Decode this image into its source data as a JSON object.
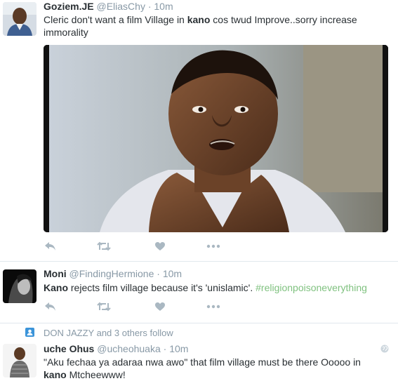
{
  "tweets": [
    {
      "name": "Goziem.JE",
      "handle": "@EliasChy",
      "separator": "·",
      "time": "10m",
      "text_before": "Cleric don't want a film Village in ",
      "keyword": "kano",
      "text_after": " cos twud Improve..sorry increase immorality"
    },
    {
      "name": "Moni",
      "handle": "@FindingHermione",
      "separator": "·",
      "time": "10m",
      "keyword": "Kano",
      "text_after": " rejects film village  because it's 'unislamic'. ",
      "hashtag": "#religionpoisoneverything"
    },
    {
      "social_context": "DON JAZZY and 3 others follow",
      "name": "uche Ohus",
      "handle": "@ucheohuaka",
      "separator": "·",
      "time": "10m",
      "text_before": "\"Aku fechaa ya adaraa nwa  awo\"  that film village must be there Ooooo in ",
      "keyword": "kano",
      "text_after": " Mtcheewww!"
    }
  ],
  "colors": {
    "primary_text": "#292f33",
    "secondary_text": "#8899a6",
    "action_icon": "#aab8c2",
    "hashtag": "#7fc17f",
    "follow_icon": "#3b94d9",
    "divider": "#e1e8ed"
  },
  "icons": [
    "reply-icon",
    "retweet-icon",
    "like-icon",
    "more-icon",
    "follow-icon",
    "globe-icon"
  ]
}
